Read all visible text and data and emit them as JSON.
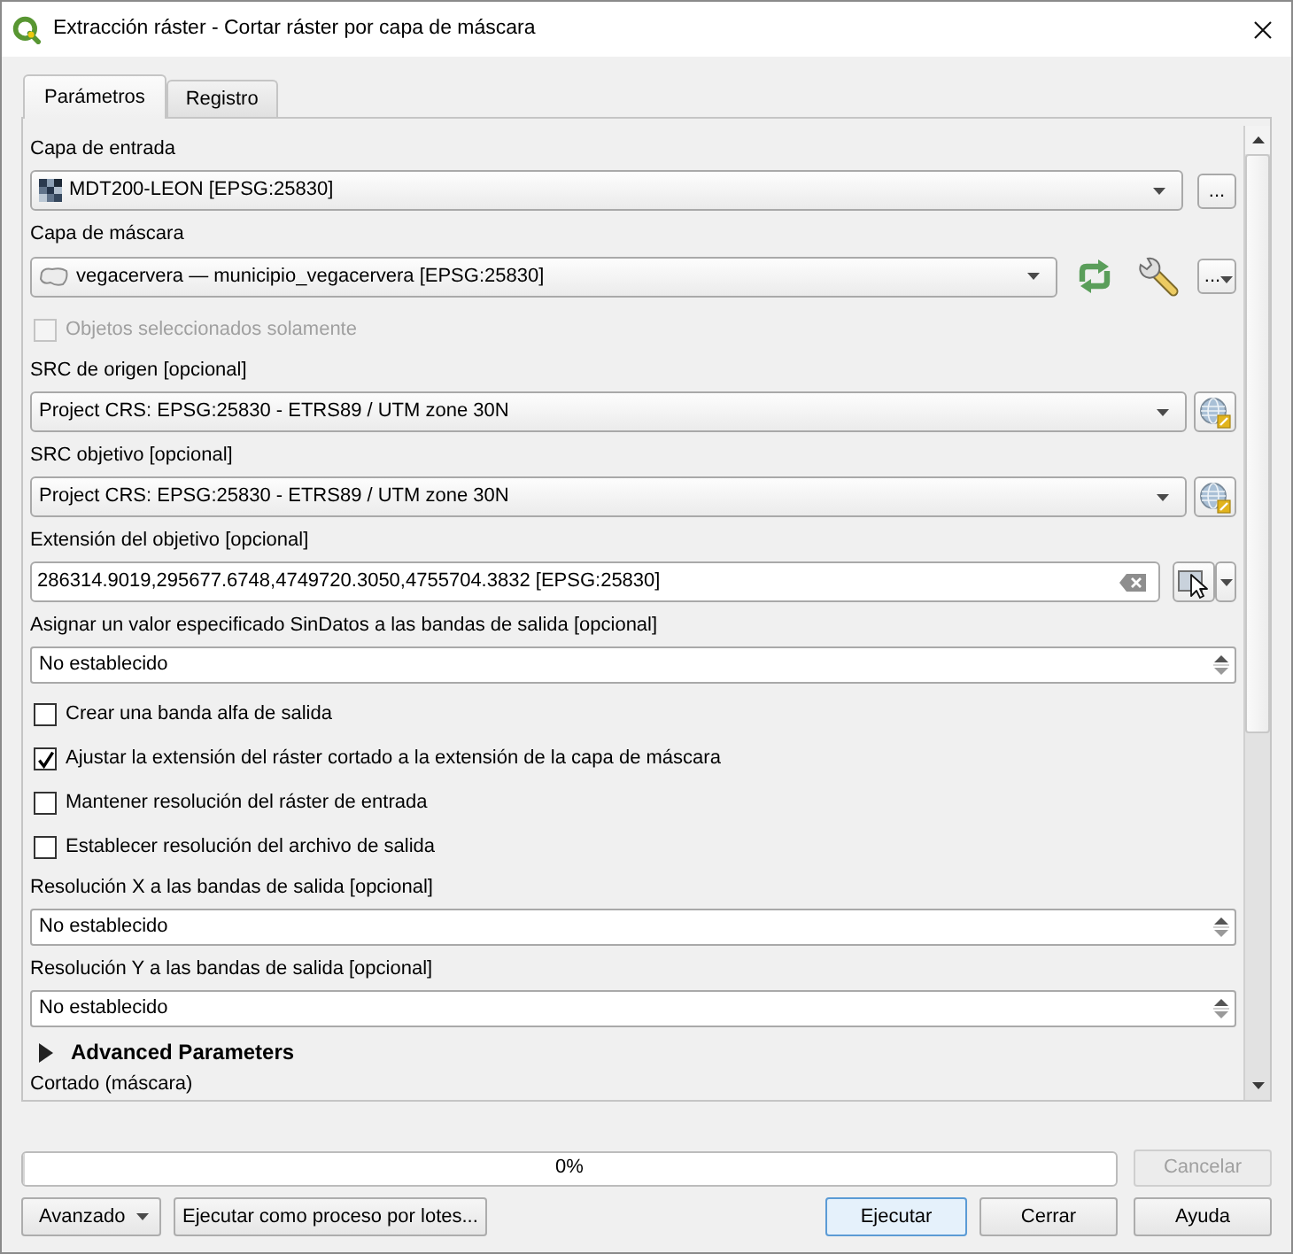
{
  "window": {
    "title": "Extracción ráster - Cortar ráster por capa de máscara"
  },
  "tabs": [
    {
      "label": "Parámetros",
      "selected": true
    },
    {
      "label": "Registro",
      "selected": false
    }
  ],
  "parameters": [
    {
      "kind": "raster_layer",
      "label": "Capa de entrada",
      "value": "MDT200-LEON [EPSG:25830]",
      "button": "...",
      "tools": false
    },
    {
      "kind": "polygon_layer",
      "label": "Capa de máscara",
      "value": "vegacervera — municipio_vegacervera [EPSG:25830]",
      "button": "...",
      "tools": true
    },
    {
      "kind": "checkbox",
      "label": "Objetos seleccionados solamente",
      "checked": false,
      "disabled": true
    },
    {
      "kind": "crs",
      "label": "SRC de origen [opcional]",
      "value": "Project CRS: EPSG:25830 - ETRS89 / UTM zone 30N"
    },
    {
      "kind": "crs",
      "label": "SRC objetivo [opcional]",
      "value": "Project CRS: EPSG:25830 - ETRS89 / UTM zone 30N"
    },
    {
      "kind": "extent",
      "label": "Extensión del objetivo [opcional]",
      "value": "286314.9019,295677.6748,4749720.3050,4755704.3832 [EPSG:25830]"
    },
    {
      "kind": "spin",
      "label": "Asignar un valor especificado SinDatos a las bandas de salida [opcional]",
      "value": "No establecido"
    },
    {
      "kind": "checkbox",
      "label": "Crear una banda alfa de salida",
      "checked": false,
      "disabled": false
    },
    {
      "kind": "checkbox",
      "label": "Ajustar la extensión del ráster cortado a la extensión de la capa de máscara",
      "checked": true,
      "disabled": false
    },
    {
      "kind": "checkbox",
      "label": "Mantener resolución del ráster de entrada",
      "checked": false,
      "disabled": false
    },
    {
      "kind": "checkbox",
      "label": "Establecer resolución del archivo de salida",
      "checked": false,
      "disabled": false
    },
    {
      "kind": "spin",
      "label": "Resolución X a las bandas de salida [opcional]",
      "value": "No establecido"
    },
    {
      "kind": "spin",
      "label": "Resolución Y a las bandas de salida [opcional]",
      "value": "No establecido"
    },
    {
      "kind": "group",
      "label": "Advanced Parameters",
      "expanded": false
    },
    {
      "kind": "output",
      "label": "Cortado (máscara)"
    }
  ],
  "progress": {
    "level": 0,
    "text": "0%"
  },
  "cancel_button": {
    "label": "Cancelar",
    "disabled": true
  },
  "left_buttons": [
    {
      "label": "Avanzado",
      "kind": "menu"
    },
    {
      "label": "Ejecutar como proceso por lotes...",
      "kind": "plain"
    }
  ],
  "right_buttons": [
    {
      "label": "Ejecutar",
      "kind": "default"
    },
    {
      "label": "Cerrar",
      "kind": "plain"
    },
    {
      "label": "Ayuda",
      "kind": "plain"
    }
  ]
}
